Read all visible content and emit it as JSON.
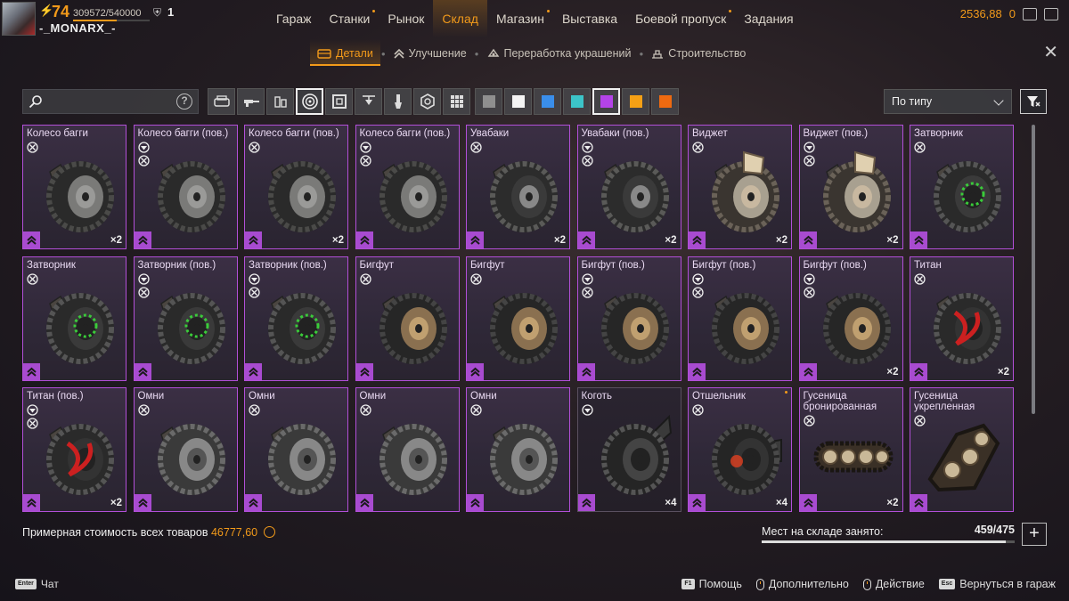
{
  "player": {
    "level": "74",
    "xp": "309572/540000",
    "xp_fraction": 0.5725,
    "clan_count": "1",
    "username": "-_MONARX_-"
  },
  "main_nav": [
    {
      "label": "Гараж",
      "new": false
    },
    {
      "label": "Станки",
      "new": true
    },
    {
      "label": "Рынок",
      "new": false
    },
    {
      "label": "Склад",
      "new": false,
      "active": true
    },
    {
      "label": "Магазин",
      "new": true
    },
    {
      "label": "Выставка",
      "new": false
    },
    {
      "label": "Боевой пропуск",
      "new": true
    },
    {
      "label": "Задания",
      "new": false
    }
  ],
  "top_right": {
    "coins": "2536,88",
    "coupons": "0"
  },
  "sub_nav": [
    {
      "label": "Детали",
      "icon": "crate-icon",
      "active": true
    },
    {
      "label": "Улучшение",
      "icon": "upgrade-icon"
    },
    {
      "label": "Переработка украшений",
      "icon": "recycle-icon"
    },
    {
      "label": "Строительство",
      "icon": "build-icon"
    }
  ],
  "search": {
    "value": "",
    "placeholder": ""
  },
  "category_filters": [
    {
      "icon": "cabin-icon"
    },
    {
      "icon": "weapon-icon"
    },
    {
      "icon": "hardware-icon"
    },
    {
      "icon": "wheel-icon",
      "selected": true
    },
    {
      "icon": "frame-icon"
    },
    {
      "icon": "drone-icon"
    },
    {
      "icon": "paint-icon"
    },
    {
      "icon": "engine-icon"
    },
    {
      "icon": "all-grid-icon"
    }
  ],
  "color_filters": [
    {
      "color": "#8f8f8f"
    },
    {
      "color": "#f4f4f4"
    },
    {
      "color": "#3a8eea"
    },
    {
      "color": "#3cc4c8"
    },
    {
      "color": "#b443e8",
      "selected": true
    },
    {
      "color": "#f5a015"
    },
    {
      "color": "#ee6a10"
    }
  ],
  "sort": {
    "label": "По типу"
  },
  "items": [
    {
      "name": "Колесо багги",
      "icons": [
        "no-tools-icon"
      ],
      "count": "×2",
      "art": "tire"
    },
    {
      "name": "Колесо багги (пов.)",
      "icons": [
        "craft-icon",
        "no-tools-icon"
      ],
      "count": "",
      "art": "tire"
    },
    {
      "name": "Колесо багги (пов.)",
      "icons": [
        "no-tools-icon"
      ],
      "count": "×2",
      "art": "tire"
    },
    {
      "name": "Колесо багги (пов.)",
      "icons": [
        "craft-icon",
        "no-tools-icon"
      ],
      "count": "",
      "art": "tire"
    },
    {
      "name": "Увабаки",
      "icons": [
        "no-tools-icon"
      ],
      "count": "×2",
      "art": "spiked"
    },
    {
      "name": "Увабаки (пов.)",
      "icons": [
        "craft-icon",
        "no-tools-icon"
      ],
      "count": "×2",
      "art": "spiked"
    },
    {
      "name": "Виджет",
      "icons": [
        "no-tools-icon"
      ],
      "count": "×2",
      "art": "widget"
    },
    {
      "name": "Виджет (пов.)",
      "icons": [
        "craft-icon",
        "no-tools-icon"
      ],
      "count": "×2",
      "art": "widget"
    },
    {
      "name": "Затворник",
      "icons": [
        "no-tools-icon"
      ],
      "count": "",
      "art": "green"
    },
    {
      "name": "Затворник",
      "icons": [
        "no-tools-icon"
      ],
      "count": "",
      "art": "green"
    },
    {
      "name": "Затворник (пов.)",
      "icons": [
        "craft-icon",
        "no-tools-icon"
      ],
      "count": "",
      "art": "green"
    },
    {
      "name": "Затворник (пов.)",
      "icons": [
        "craft-icon",
        "no-tools-icon"
      ],
      "count": "",
      "art": "green"
    },
    {
      "name": "Бигфут",
      "icons": [
        "no-tools-icon"
      ],
      "count": "",
      "art": "bigfoot"
    },
    {
      "name": "Бигфут",
      "icons": [
        "no-tools-icon"
      ],
      "count": "",
      "art": "bigfoot"
    },
    {
      "name": "Бигфут (пов.)",
      "icons": [
        "craft-icon",
        "no-tools-icon"
      ],
      "count": "",
      "art": "bigfoot"
    },
    {
      "name": "Бигфут (пов.)",
      "icons": [
        "craft-icon",
        "no-tools-icon"
      ],
      "count": "",
      "art": "bigfoot"
    },
    {
      "name": "Бигфут (пов.)",
      "icons": [
        "craft-icon",
        "no-tools-icon"
      ],
      "count": "×2",
      "art": "bigfoot"
    },
    {
      "name": "Титан",
      "icons": [
        "no-tools-icon"
      ],
      "count": "×2",
      "art": "titan"
    },
    {
      "name": "Титан (пов.)",
      "icons": [
        "craft-icon",
        "no-tools-icon"
      ],
      "count": "×2",
      "art": "titan"
    },
    {
      "name": "Омни",
      "icons": [
        "no-tools-icon"
      ],
      "count": "",
      "art": "omni"
    },
    {
      "name": "Омни",
      "icons": [
        "no-tools-icon"
      ],
      "count": "",
      "art": "omni"
    },
    {
      "name": "Омни",
      "icons": [
        "no-tools-icon"
      ],
      "count": "",
      "art": "omni"
    },
    {
      "name": "Омни",
      "icons": [
        "no-tools-icon"
      ],
      "count": "",
      "art": "omni"
    },
    {
      "name": "Коготь",
      "icons": [
        "craft-icon"
      ],
      "count": "×4",
      "art": "claw",
      "plain": true
    },
    {
      "name": "Отшельник",
      "icons": [
        "no-tools-icon"
      ],
      "count": "×4",
      "art": "hermit",
      "new": true
    },
    {
      "name": "Гусеница бронированная",
      "icons": [
        "no-tools-icon"
      ],
      "count": "×2",
      "art": "track"
    },
    {
      "name": "Гусеница укрепленная",
      "icons": [
        "no-tools-icon"
      ],
      "count": "",
      "art": "track2"
    }
  ],
  "footer": {
    "cost_label": "Примерная стоимость всех товаров",
    "cost_value": "46777,60",
    "storage_label": "Мест на складе занято:",
    "storage_value": "459/475",
    "storage_fraction": 0.966
  },
  "hints": {
    "chat_key": "Enter",
    "chat_label": "Чат",
    "help_key": "F1",
    "help_label": "Помощь",
    "more_label": "Дополнительно",
    "action_label": "Действие",
    "back_key": "Esc",
    "back_label": "Вернуться в гараж"
  }
}
